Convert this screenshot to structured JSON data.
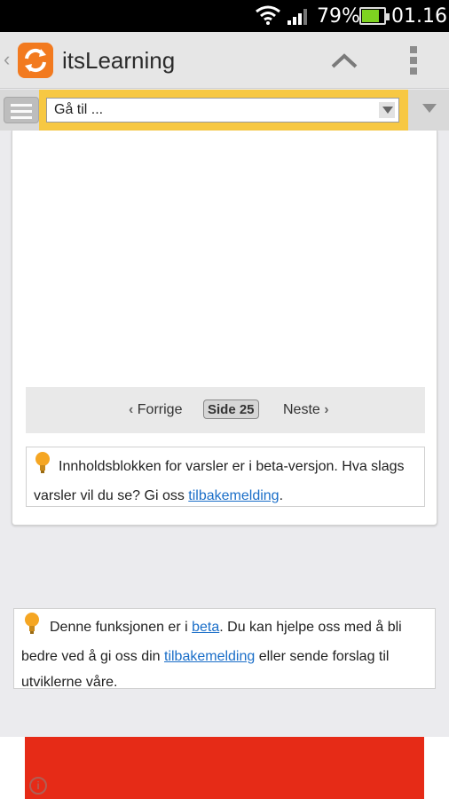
{
  "status_bar": {
    "battery_percent": "79%",
    "time": "01.16",
    "battery_level": 0.79
  },
  "app_bar": {
    "title": "itsLearning"
  },
  "goto_bar": {
    "selected": "Gå til ..."
  },
  "pager": {
    "prev_label": "Forrige",
    "current_label": "Side 25",
    "next_label": "Neste"
  },
  "notice": {
    "text": "Innholdsblokken for varsler er i beta-versjon. Hva slags varsler vil du se? Gi oss ",
    "link": "tilbakemelding",
    "after_link": "."
  },
  "beta_info": {
    "text_1": "Denne funksjonen er i ",
    "link_beta": "beta",
    "text_2": ". Du kan hjelpe oss med å bli bedre ved å gi oss din ",
    "link_feedback": "tilbakemelding",
    "text_3": " eller sende forslag til utviklerne våre."
  },
  "ad": {
    "info_icon": "i",
    "color": "#e62b17"
  },
  "colors": {
    "accent": "#f27a1f",
    "goto_highlight": "#f7c843",
    "link": "#1a6ec8"
  }
}
